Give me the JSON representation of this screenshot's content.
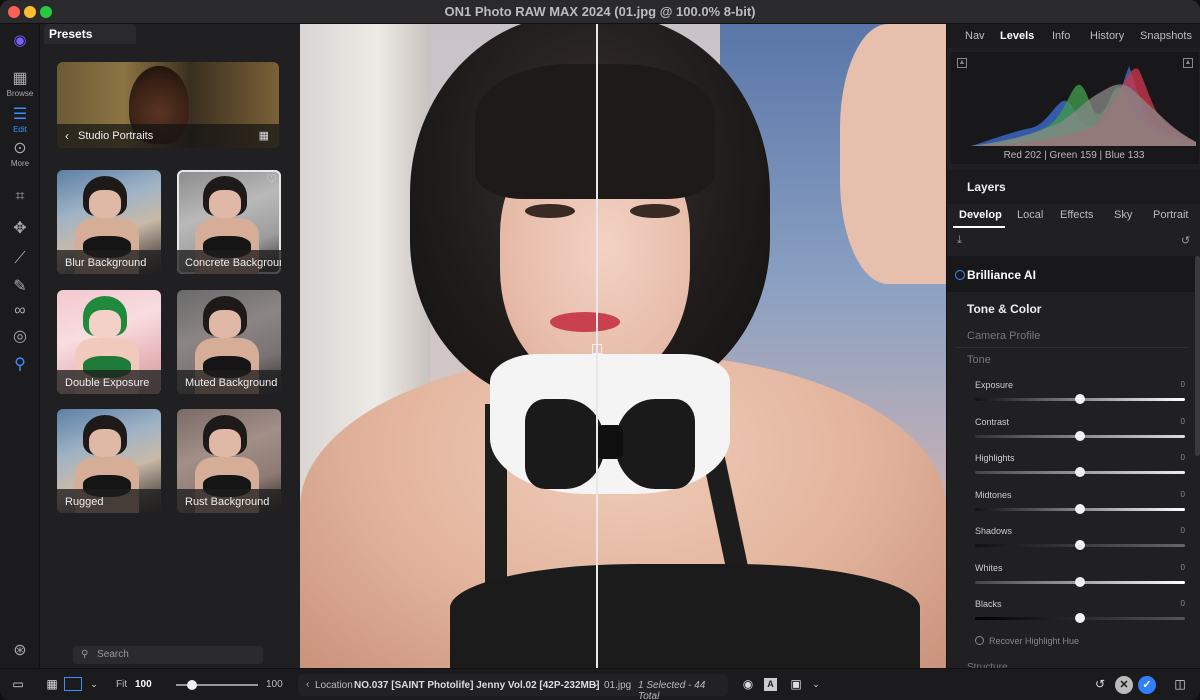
{
  "window": {
    "title": "ON1 Photo RAW MAX 2024 (01.jpg @ 100.0% 8-bit)"
  },
  "colors": {
    "accent": "#2f7fff",
    "panel": "#202022",
    "rail": "#1b1b1d"
  },
  "rail": {
    "items": [
      {
        "icon": "browse-icon",
        "label": "Browse"
      },
      {
        "icon": "edit-sliders-icon",
        "label": "Edit"
      },
      {
        "icon": "more-icon",
        "label": "More"
      }
    ],
    "tools": [
      "crop-icon",
      "move-icon",
      "magic-wand-icon",
      "brush-icon",
      "layers-blend-icon",
      "fingerprint-icon",
      "zoom-icon",
      "help-icon"
    ]
  },
  "presets": {
    "tab_label": "Presets",
    "category": "Studio Portraits",
    "items": [
      {
        "label": "Blur Background"
      },
      {
        "label": "Concrete Background"
      },
      {
        "label": "Double Exposure"
      },
      {
        "label": "Muted Background"
      },
      {
        "label": "Rugged"
      },
      {
        "label": "Rust Background"
      }
    ],
    "search_placeholder": "Search"
  },
  "right_panel": {
    "tabs": [
      "Nav",
      "Levels",
      "Info",
      "History",
      "Snapshots"
    ],
    "active_tab": "Levels",
    "rgb_readout": "Red 202 | Green 159 | Blue 133",
    "layers_title": "Layers",
    "develop_tabs": [
      "Develop",
      "Local",
      "Effects",
      "Sky",
      "Portrait"
    ],
    "active_develop_tab": "Develop",
    "brilliance_label": "Brilliance AI",
    "tone_color_title": "Tone & Color",
    "camera_profile_label": "Camera Profile",
    "tone_label": "Tone",
    "sliders": [
      {
        "label": "Exposure",
        "value": "0",
        "position": 0.5
      },
      {
        "label": "Contrast",
        "value": "0",
        "position": 0.5
      },
      {
        "label": "Highlights",
        "value": "0",
        "position": 0.5
      },
      {
        "label": "Midtones",
        "value": "0",
        "position": 0.5
      },
      {
        "label": "Shadows",
        "value": "0",
        "position": 0.5
      },
      {
        "label": "Whites",
        "value": "0",
        "position": 0.5
      },
      {
        "label": "Blacks",
        "value": "0",
        "position": 0.5
      }
    ],
    "recover_label": "Recover Highlight Hue",
    "next_section_label": "Structure"
  },
  "statusbar": {
    "fit_label": "Fit",
    "zoom_value": "100",
    "zoom_max": "100",
    "zoom_position": 0.2,
    "location_label": "Location",
    "location_path": "NO.037 [SAINT Photolife] Jenny Vol.02 [42P-232MB]",
    "file_name": "01.jpg",
    "selection_info": "1 Selected - 44 Total",
    "cancel_symbol": "✕",
    "ok_symbol": "✓"
  }
}
